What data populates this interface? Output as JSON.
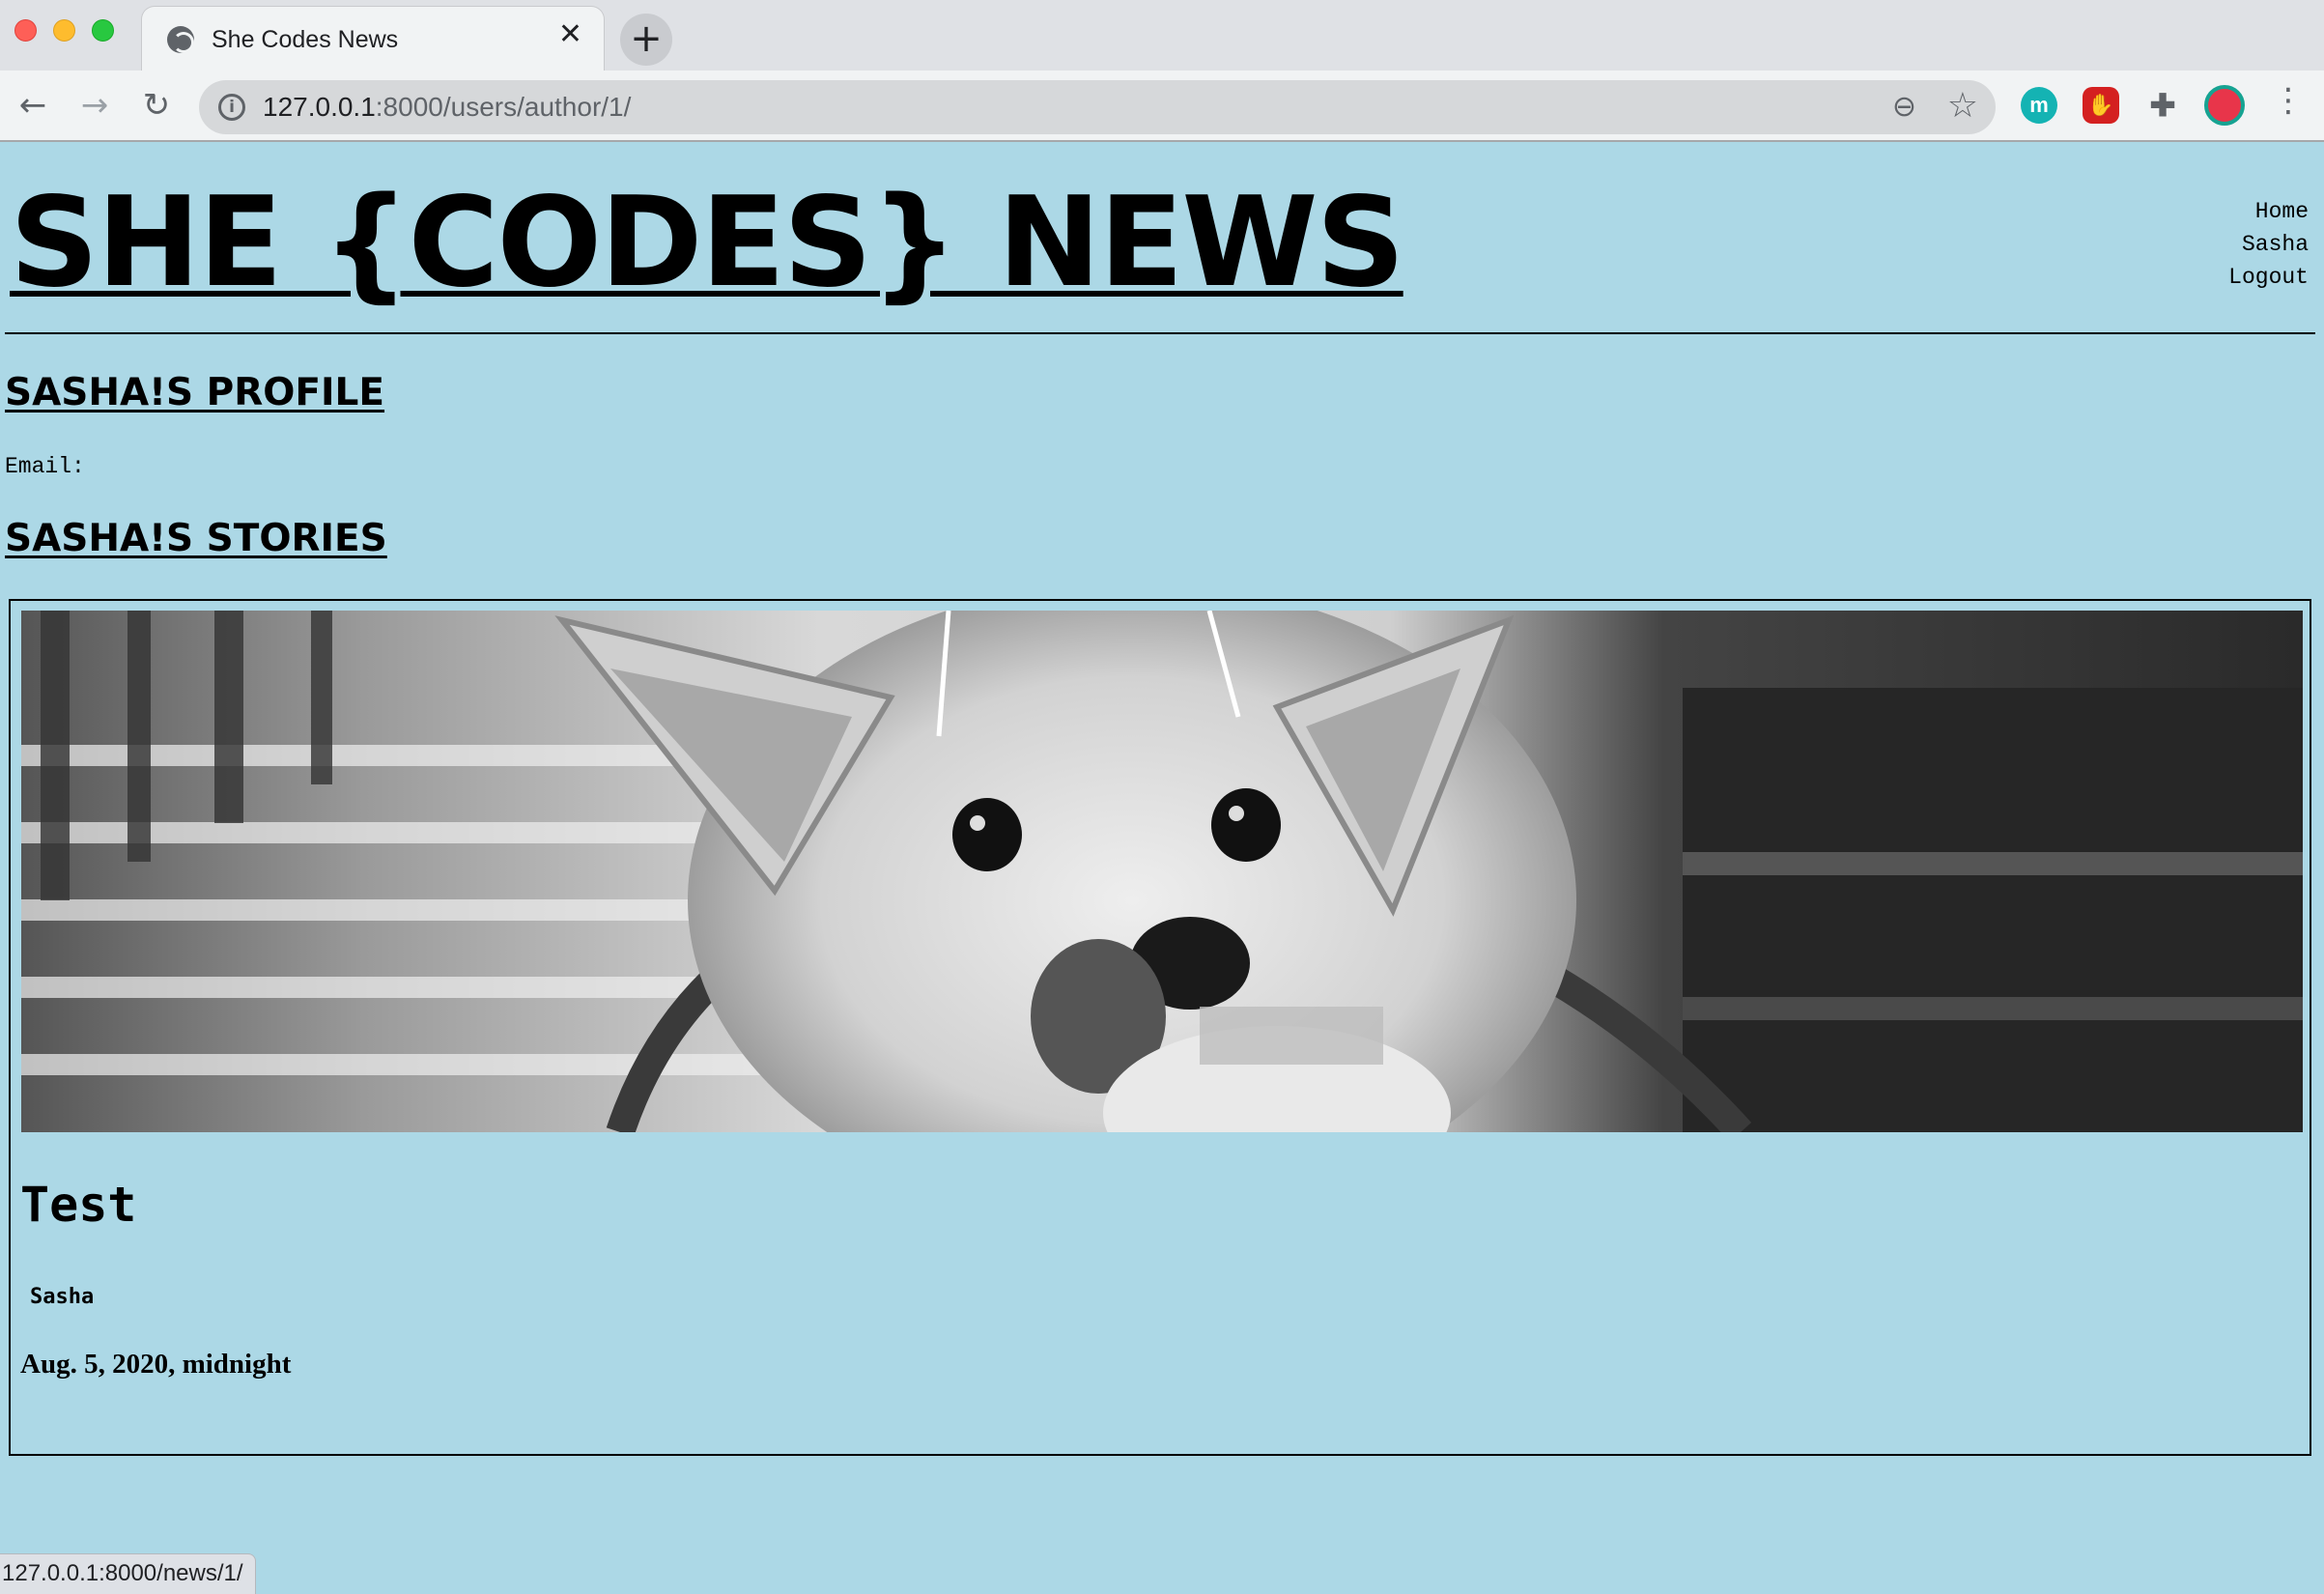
{
  "browser": {
    "tab_title": "She Codes News",
    "tab_close": "✕",
    "new_tab": "+",
    "url_host": "127.0.0.1",
    "url_rest": ":8000/users/author/1/",
    "status_url": "127.0.0.1:8000/news/1/",
    "extensions": {
      "m_label": "m"
    }
  },
  "site": {
    "title": "SHE {CODES} NEWS",
    "nav": [
      "Home",
      "Sasha",
      "Logout"
    ]
  },
  "profile": {
    "heading": "SASHA!S PROFILE",
    "email_label": "Email:",
    "email_value": ""
  },
  "stories": {
    "heading": "SASHA!S STORIES",
    "items": [
      {
        "image": "black-and-white photo of a dog licking its nose",
        "title": "Test",
        "author": "Sasha",
        "date": "Aug. 5, 2020, midnight"
      }
    ]
  }
}
